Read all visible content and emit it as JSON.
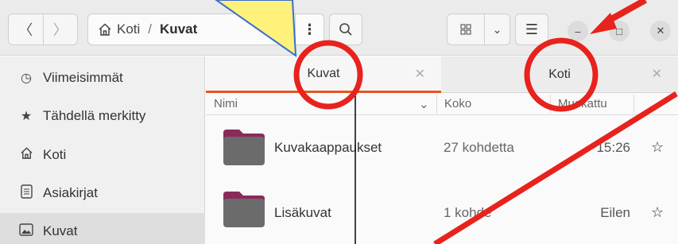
{
  "nav": {
    "back_icon": "chevron-left-icon",
    "forward_icon": "chevron-right-icon"
  },
  "pathbar": {
    "home": "Koti",
    "separator": "/",
    "current": "Kuvat"
  },
  "sidebar": {
    "items": [
      {
        "label": "Viimeisimmät",
        "icon": "clock-icon",
        "active": false
      },
      {
        "label": "Tähdellä merkitty",
        "icon": "star-icon",
        "active": false
      },
      {
        "label": "Koti",
        "icon": "home-icon",
        "active": false
      },
      {
        "label": "Asiakirjat",
        "icon": "document-icon",
        "active": false
      },
      {
        "label": "Kuvat",
        "icon": "image-icon",
        "active": true
      }
    ]
  },
  "tabs": [
    {
      "label": "Kuvat",
      "active": true
    },
    {
      "label": "Koti",
      "active": false
    }
  ],
  "columns": {
    "name": "Nimi",
    "size": "Koko",
    "modified": "Muokattu"
  },
  "files": [
    {
      "name": "Kuvakaappaukset",
      "size": "27 kohdetta",
      "modified": "15:26"
    },
    {
      "name": "Lisäkuvat",
      "size": "1 kohde",
      "modified": "Eilen"
    }
  ],
  "colors": {
    "accent": "#e95420",
    "folder": "#6b6b6b",
    "folder_tab": "#8a2a5a",
    "annotation_red": "#e8221c",
    "annotation_yellow": "#fff27a"
  }
}
